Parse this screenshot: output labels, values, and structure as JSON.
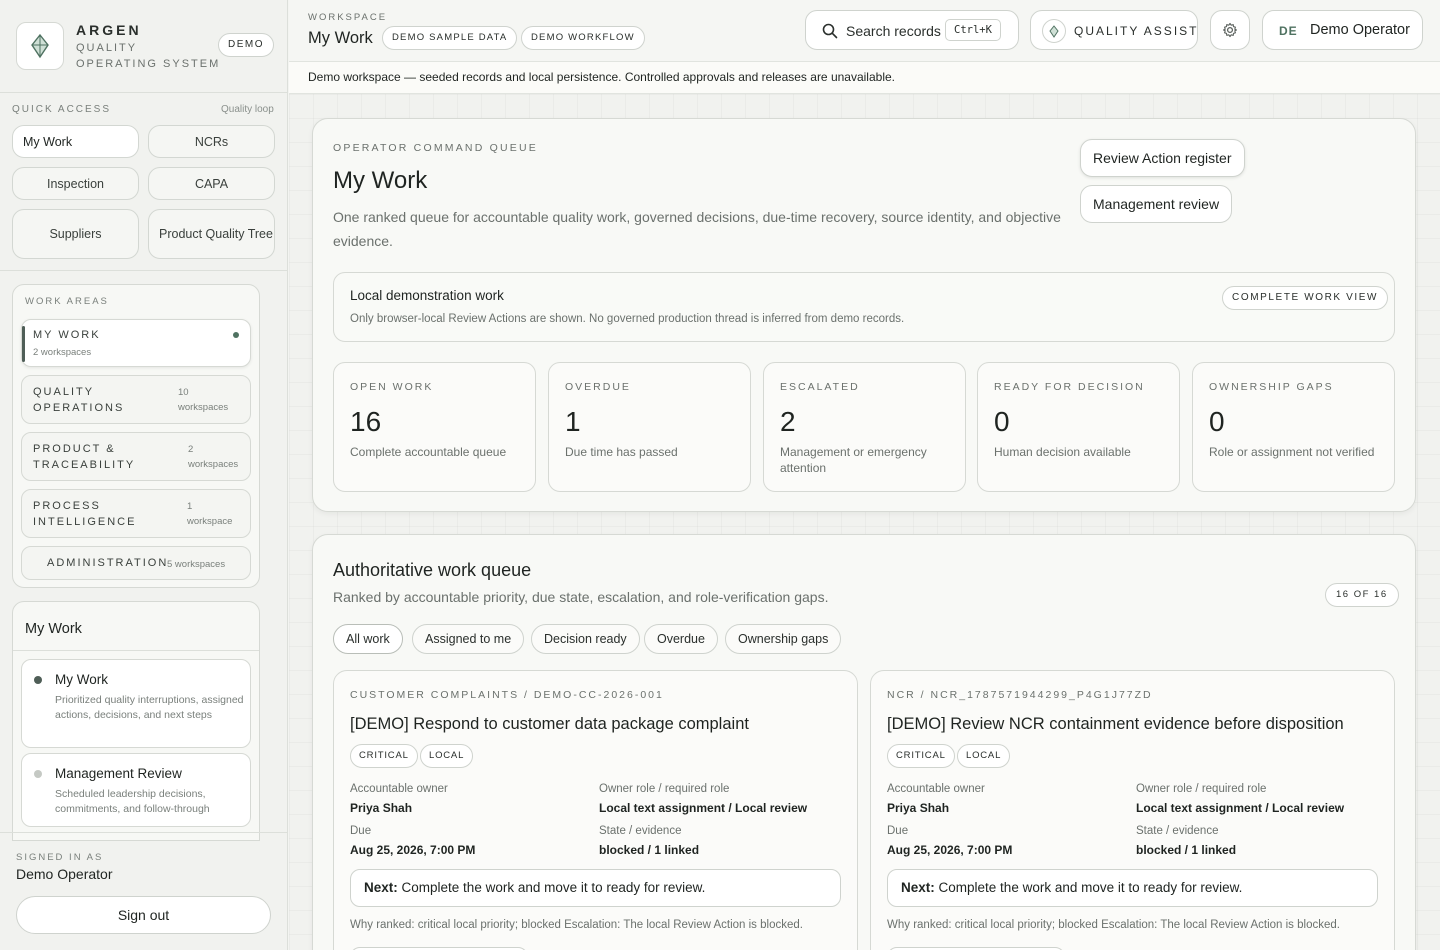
{
  "brand": {
    "name": "ARGEN",
    "line1": "QUALITY",
    "line2": "OPERATING SYSTEM",
    "badge": "DEMO"
  },
  "quick_access": {
    "label": "QUICK ACCESS",
    "hint": "Quality loop",
    "items": [
      "My Work",
      "NCRs",
      "Inspection",
      "CAPA",
      "Suppliers",
      "Product Quality Tree"
    ]
  },
  "work_areas": {
    "label": "WORK AREAS",
    "items": [
      {
        "title": "MY WORK",
        "count": "2 workspaces"
      },
      {
        "title": "QUALITY OPERATIONS",
        "count_num": "10",
        "count_unit": "workspaces"
      },
      {
        "title": "PRODUCT & TRACEABILITY",
        "count_num": "2",
        "count_unit": "workspaces"
      },
      {
        "title": "PROCESS INTELLIGENCE",
        "count_num": "1",
        "count_unit": "workspace"
      },
      {
        "title": "ADMINISTRATION",
        "count": "5 workspaces"
      }
    ]
  },
  "submenu": {
    "title": "My Work",
    "items": [
      {
        "title": "My Work",
        "desc": "Prioritized quality interruptions, assigned actions, decisions, and next steps"
      },
      {
        "title": "Management Review",
        "desc": "Scheduled leadership decisions, commitments, and follow-through"
      }
    ]
  },
  "user": {
    "signed_label": "SIGNED IN AS",
    "name": "Demo Operator",
    "signout": "Sign out",
    "initials": "DE"
  },
  "topbar": {
    "ws_label": "WORKSPACE",
    "ws_title": "My Work",
    "pill1": "DEMO SAMPLE DATA",
    "pill2": "DEMO WORKFLOW",
    "search": "Search records",
    "shortcut": "Ctrl+K",
    "assist": "QUALITY ASSIST"
  },
  "banner": "Demo workspace — seeded records and local persistence. Controlled approvals and releases are unavailable.",
  "command": {
    "eyebrow": "OPERATOR COMMAND QUEUE",
    "title": "My Work",
    "lead": "One ranked queue for accountable quality work, governed decisions, due-time recovery, source identity, and objective evidence.",
    "btn1": "Review Action register",
    "btn2": "Management review",
    "local_title": "Local demonstration work",
    "local_desc": "Only browser-local Review Actions are shown. No governed production thread is inferred from demo records.",
    "local_btn": "COMPLETE WORK VIEW",
    "stats": [
      {
        "label": "OPEN WORK",
        "value": "16",
        "hint": "Complete accountable queue"
      },
      {
        "label": "OVERDUE",
        "value": "1",
        "hint": "Due time has passed"
      },
      {
        "label": "ESCALATED",
        "value": "2",
        "hint": "Management or emergency attention"
      },
      {
        "label": "READY FOR DECISION",
        "value": "0",
        "hint": "Human decision available"
      },
      {
        "label": "OWNERSHIP GAPS",
        "value": "0",
        "hint": "Role or assignment not verified"
      }
    ]
  },
  "queue": {
    "title": "Authoritative work queue",
    "sub": "Ranked by accountable priority, due state, escalation, and role-verification gaps.",
    "count": "16 OF 16",
    "filters": [
      "All work",
      "Assigned to me",
      "Decision ready",
      "Overdue",
      "Ownership gaps"
    ],
    "cards": [
      {
        "source": "CUSTOMER COMPLAINTS / DEMO-CC-2026-001",
        "title": "[DEMO] Respond to customer data package complaint",
        "tags": [
          "CRITICAL",
          "LOCAL"
        ],
        "owner_label": "Accountable owner",
        "owner": "Priya Shah",
        "role_label": "Owner role / required role",
        "role": "Local text assignment / Local review",
        "due_label": "Due",
        "due": "Aug 25, 2026, 7:00 PM",
        "state_label": "State / evidence",
        "state": "blocked / 1 linked",
        "next_label": "Next:",
        "next": "Complete the work and move it to ready for review.",
        "why": "Why ranked: critical local priority; blocked Escalation: The local Review Action is blocked."
      },
      {
        "source": "NCR / NCR_1787571944299_P4G1J77ZD",
        "title": "[DEMO] Review NCR containment evidence before disposition",
        "tags": [
          "CRITICAL",
          "LOCAL"
        ],
        "owner_label": "Accountable owner",
        "owner": "Priya Shah",
        "role_label": "Owner role / required role",
        "role": "Local text assignment / Local review",
        "due_label": "Due",
        "due": "Aug 25, 2026, 7:00 PM",
        "state_label": "State / evidence",
        "state": "blocked / 1 linked",
        "next_label": "Next:",
        "next": "Complete the work and move it to ready for review.",
        "why": "Why ranked: critical local priority; blocked Escalation: The local Review Action is blocked."
      }
    ]
  }
}
